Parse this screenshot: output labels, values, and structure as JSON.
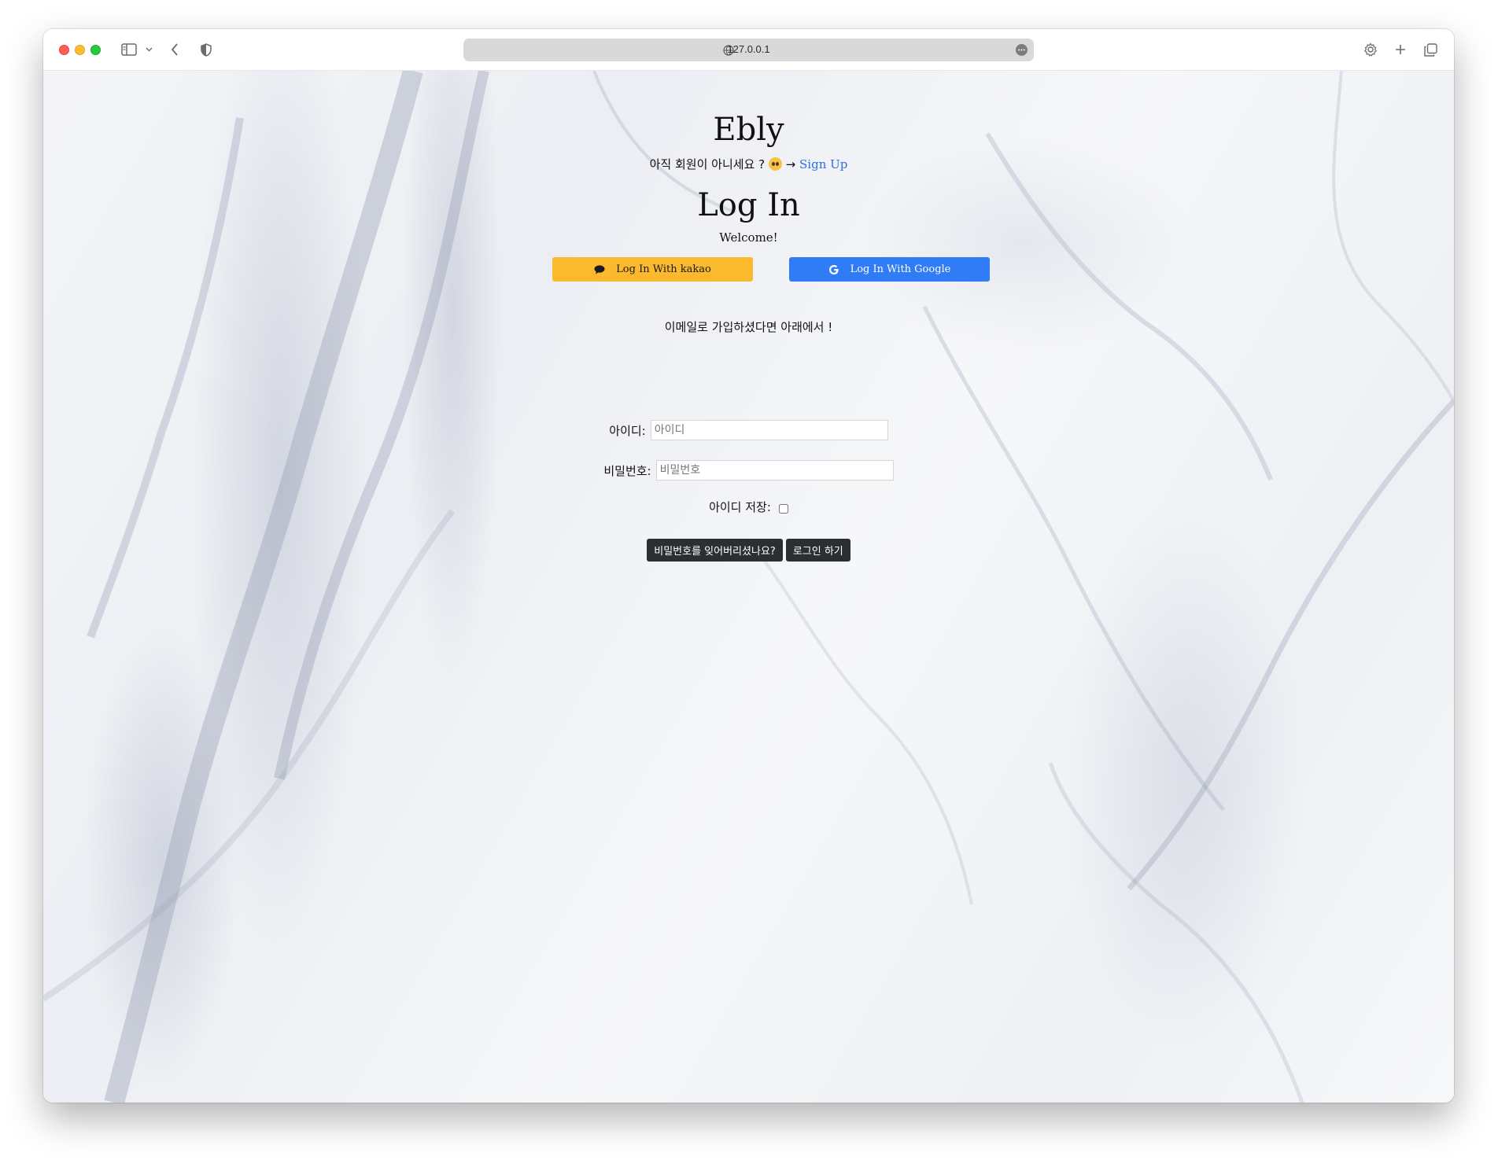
{
  "browser": {
    "url": "127.0.0.1"
  },
  "page": {
    "brand": "Ebly",
    "signup_prompt": "아직 회원이 아니세요 ?",
    "signup_arrow": "→",
    "signup_link": "Sign Up",
    "title": "Log In",
    "welcome": "Welcome!",
    "kakao_button": "Log In With kakao",
    "google_button": "Log In With Google",
    "email_note": "이메일로 가입하셨다면 아래에서 !",
    "id_label": "아이디:",
    "id_placeholder": "아이디",
    "password_label": "비밀번호:",
    "password_placeholder": "비밀번호",
    "save_id_label": "아이디 저장:",
    "forgot_password_button": "비밀번호를 잊어버리셨나요?",
    "login_button": "로그인 하기"
  },
  "colors": {
    "kakao": "#fbb92e",
    "google": "#2f7cf6",
    "link": "#2f6fe0",
    "dark_button": "#2b2f33"
  },
  "icons": [
    "sidebar-icon",
    "back-icon",
    "shield-icon",
    "globe-icon",
    "more-icon",
    "settings-icon",
    "plus-icon",
    "tabs-icon",
    "chat-bubble-icon",
    "google-g-icon",
    "pleading-face-emoji"
  ]
}
